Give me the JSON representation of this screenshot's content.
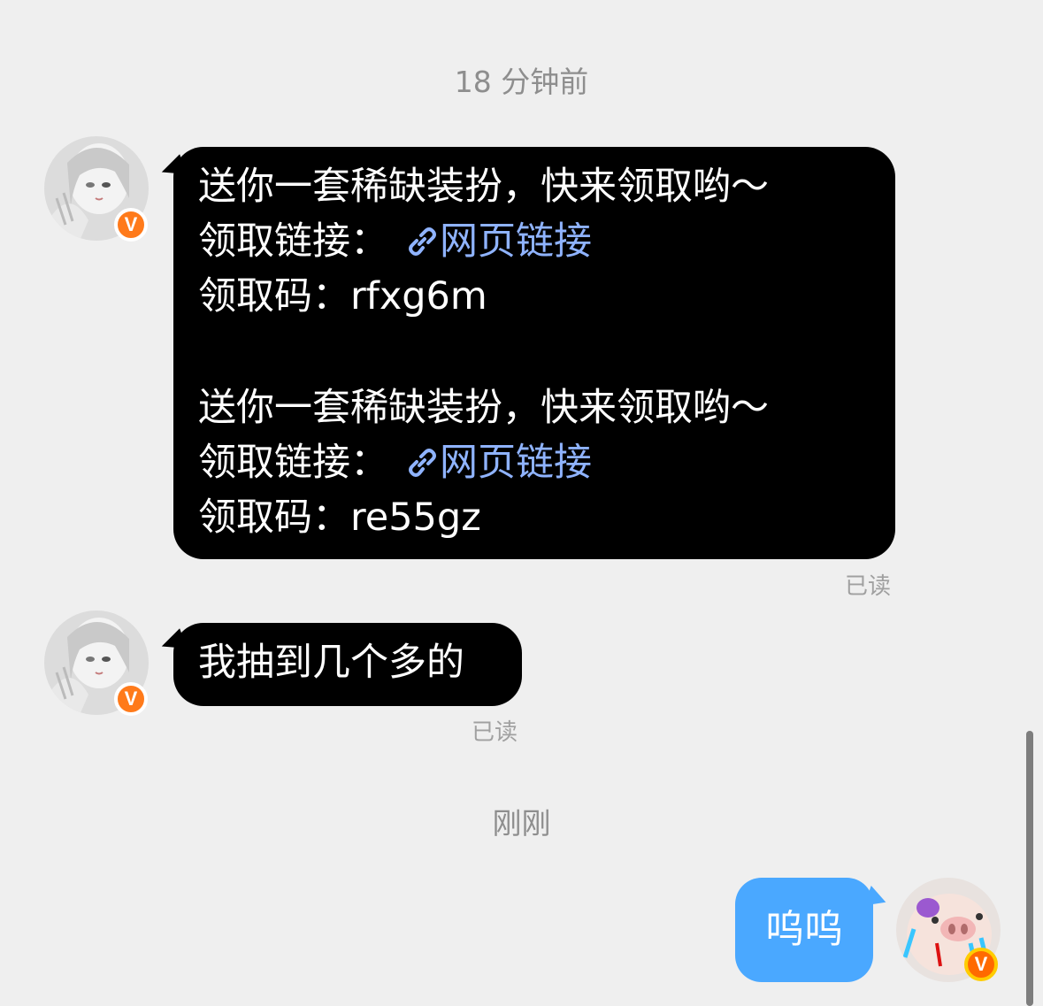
{
  "timestamps": {
    "first": "18 分钟前",
    "second": "刚刚"
  },
  "messages": {
    "gift": {
      "lines": [
        "送你一套稀缺装扮，快来领取哟～",
        "领取链接：",
        "领取码：rfxg6m",
        "送你一套稀缺装扮，快来领取哟～",
        "领取链接：",
        "领取码：re55gz"
      ],
      "link_text": "网页链接",
      "read_status": "已读"
    },
    "draw": {
      "text": "我抽到几个多的",
      "read_status": "已读"
    },
    "mine": {
      "text": "呜呜"
    }
  },
  "badge_label": "V",
  "colors": {
    "bubble_other": "#000000",
    "bubble_mine": "#4aa8ff",
    "link": "#8fb3ff",
    "badge": "#ff7a1a",
    "background": "#efefef"
  },
  "icons": [
    "link-icon",
    "verified-badge-icon"
  ]
}
